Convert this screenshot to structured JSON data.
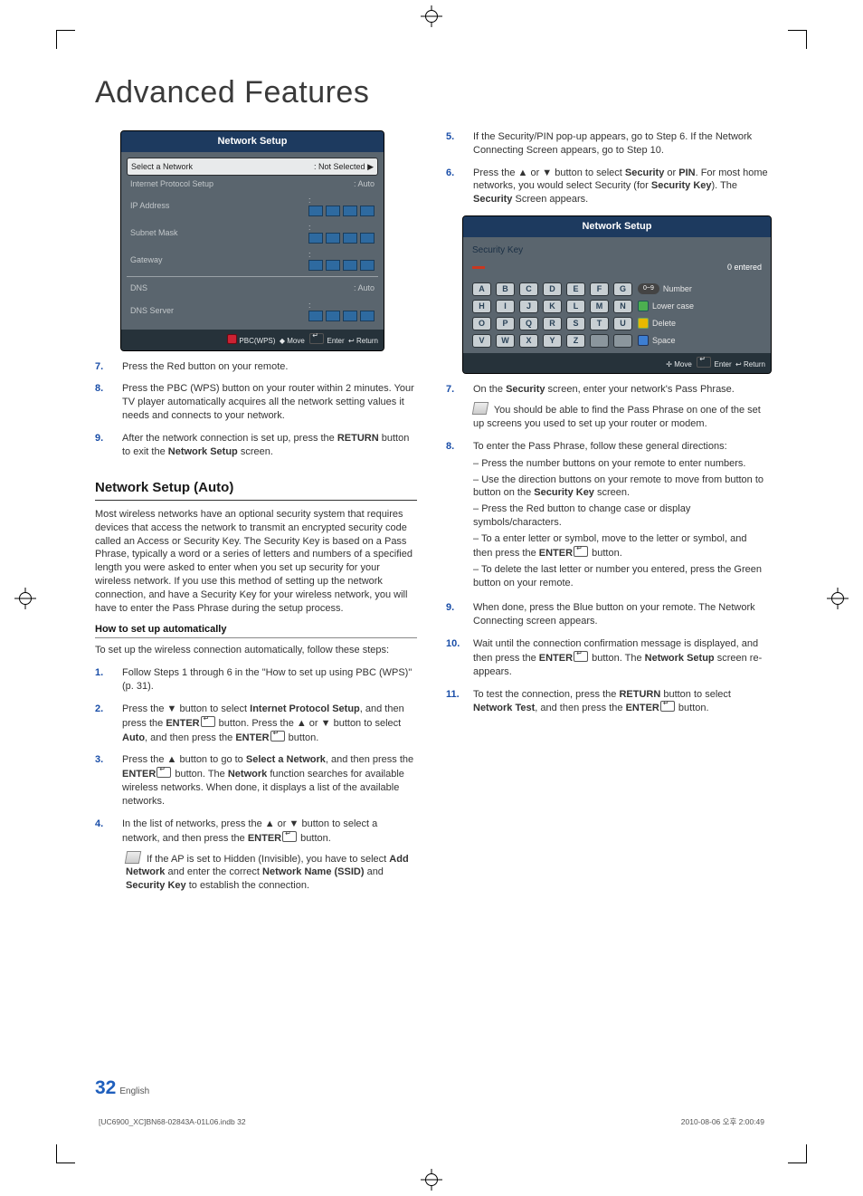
{
  "page": {
    "title": "Advanced Features",
    "number": "32",
    "lang": "English",
    "footer_left": "[UC6900_XC]BN68-02843A-01L06.indb   32",
    "footer_right": "2010-08-06   오후 2:00:49"
  },
  "ui1": {
    "title": "Network Setup",
    "rows": {
      "select_net": "Select a Network",
      "select_net_val": ": Not Selected",
      "ip_setup": "Internet Protocol Setup",
      "ip_setup_val": ": Auto",
      "ip_addr": "IP Address",
      "subnet": "Subnet Mask",
      "gateway": "Gateway",
      "dns": "DNS",
      "dns_val": ": Auto",
      "dns_server": "DNS Server"
    },
    "footer": {
      "pbc": "PBC(WPS)",
      "move": "Move",
      "enter": "Enter",
      "return": "Return"
    }
  },
  "left": {
    "s7": "Press the Red button on your remote.",
    "s8": "Press the PBC (WPS) button on your router within 2 minutes. Your TV player automatically acquires all the network setting values it needs and connects to your network.",
    "s9a": "After the network connection is set up, press the ",
    "s9_b1": "RETURN",
    "s9b": " button to exit the ",
    "s9_b2": "Network Setup",
    "s9c": " screen.",
    "section": "Network Setup (Auto)",
    "para": "Most wireless networks have an optional security system that requires devices that access the network to transmit an encrypted security code called an Access or Security Key. The Security Key is based on a Pass Phrase, typically a word or a series of letters and numbers of a specified length you were asked to enter when you set up security for your wireless network. If you use this method of setting up the network connection, and have a Security Key for your wireless network, you will have to enter the Pass Phrase during the setup process.",
    "sub": "How to set up automatically",
    "intro": "To set up the wireless connection automatically, follow these steps:",
    "a1": "Follow Steps 1 through 6 in the \"How to set up using PBC (WPS)\" (p. 31).",
    "a2a": "Press the ▼ button to select ",
    "a2_b1": "Internet Protocol Setup",
    "a2b": ", and then press the ",
    "a2_b2": "ENTER",
    "a2c": " button. Press the ▲ or ▼ button to select ",
    "a2_b3": "Auto",
    "a2d": ", and then press the ",
    "a2_b4": "ENTER",
    "a2e": " button.",
    "a3a": "Press the ▲ button to go to ",
    "a3_b1": "Select a Network",
    "a3b": ", and then press the ",
    "a3_b2": "ENTER",
    "a3c": " button. The ",
    "a3_b3": "Network",
    "a3d": " function searches for available wireless networks. When done, it displays a list of the available networks.",
    "a4a": "In the list of networks, press the ▲ or ▼ button to select a network, and then press the ",
    "a4_b1": "ENTER",
    "a4b": " button.",
    "a4_note_a": "If the AP is set to Hidden (Invisible), you have to select ",
    "a4_nb1": "Add Network",
    "a4_note_b": " and enter the correct ",
    "a4_nb2": "Network Name (SSID)",
    "a4_note_c": " and ",
    "a4_nb3": "Security Key",
    "a4_note_d": " to establish the connection."
  },
  "right": {
    "s5": "If the Security/PIN pop-up appears, go to Step 6. If the Network Connecting Screen appears, go to Step 10.",
    "s6a": "Press the ▲ or ▼ button to select ",
    "s6_b1": "Security",
    "s6b": " or ",
    "s6_b2": "PIN",
    "s6c": ". For most home networks, you would select Security (for ",
    "s6_b3": "Security Key",
    "s6d": "). The ",
    "s6_b4": "Security",
    "s6e": " Screen appears."
  },
  "ui2": {
    "title": "Network Setup",
    "seckey": "Security Key",
    "count": "0 entered",
    "rows": [
      {
        "keys": [
          "A",
          "B",
          "C",
          "D",
          "E",
          "F",
          "G"
        ],
        "lbl": "Number",
        "type": "num"
      },
      {
        "keys": [
          "H",
          "I",
          "J",
          "K",
          "L",
          "M",
          "N"
        ],
        "lbl": "Lower case",
        "type": "grn"
      },
      {
        "keys": [
          "O",
          "P",
          "Q",
          "R",
          "S",
          "T",
          "U"
        ],
        "lbl": "Delete",
        "type": "yel"
      },
      {
        "keys": [
          "V",
          "W",
          "X",
          "Y",
          "Z",
          "",
          ""
        ],
        "lbl": "Space",
        "type": "blu"
      }
    ],
    "footer": {
      "move": "Move",
      "enter": "Enter",
      "return": "Return"
    }
  },
  "right2": {
    "s7a": "On the ",
    "s7_b1": "Security",
    "s7b": " screen, enter your network's Pass Phrase.",
    "s7_note": "You should be able to find the Pass Phrase on one of the set up screens you used to set up your router or modem.",
    "s8": "To enter the Pass Phrase, follow these general directions:",
    "s8_d1": "Press the number buttons on your remote to enter numbers.",
    "s8_d2a": "Use the direction buttons on your remote to move from button to button on the ",
    "s8_d2b": "Security Key",
    "s8_d2c": " screen.",
    "s8_d3": "Press the Red button to change case or display symbols/characters.",
    "s8_d4a": "To a enter letter or symbol, move to the letter or symbol, and then press the ",
    "s8_d4b": "ENTER",
    "s8_d4c": " button.",
    "s8_d5": "To delete the last letter or number you entered, press the Green button on your remote.",
    "s9": "When done, press the Blue button on your remote. The Network Connecting screen appears.",
    "s10a": "Wait until the connection confirmation message is displayed, and then press the ",
    "s10b": "ENTER",
    "s10c": " button. The ",
    "s10d": "Network Setup",
    "s10e": " screen re-appears.",
    "s11a": "To test the connection, press the ",
    "s11b": "RETURN",
    "s11c": " button to select ",
    "s11d": "Network Test",
    "s11e": ", and then press the ",
    "s11f": "ENTER",
    "s11g": " button."
  }
}
